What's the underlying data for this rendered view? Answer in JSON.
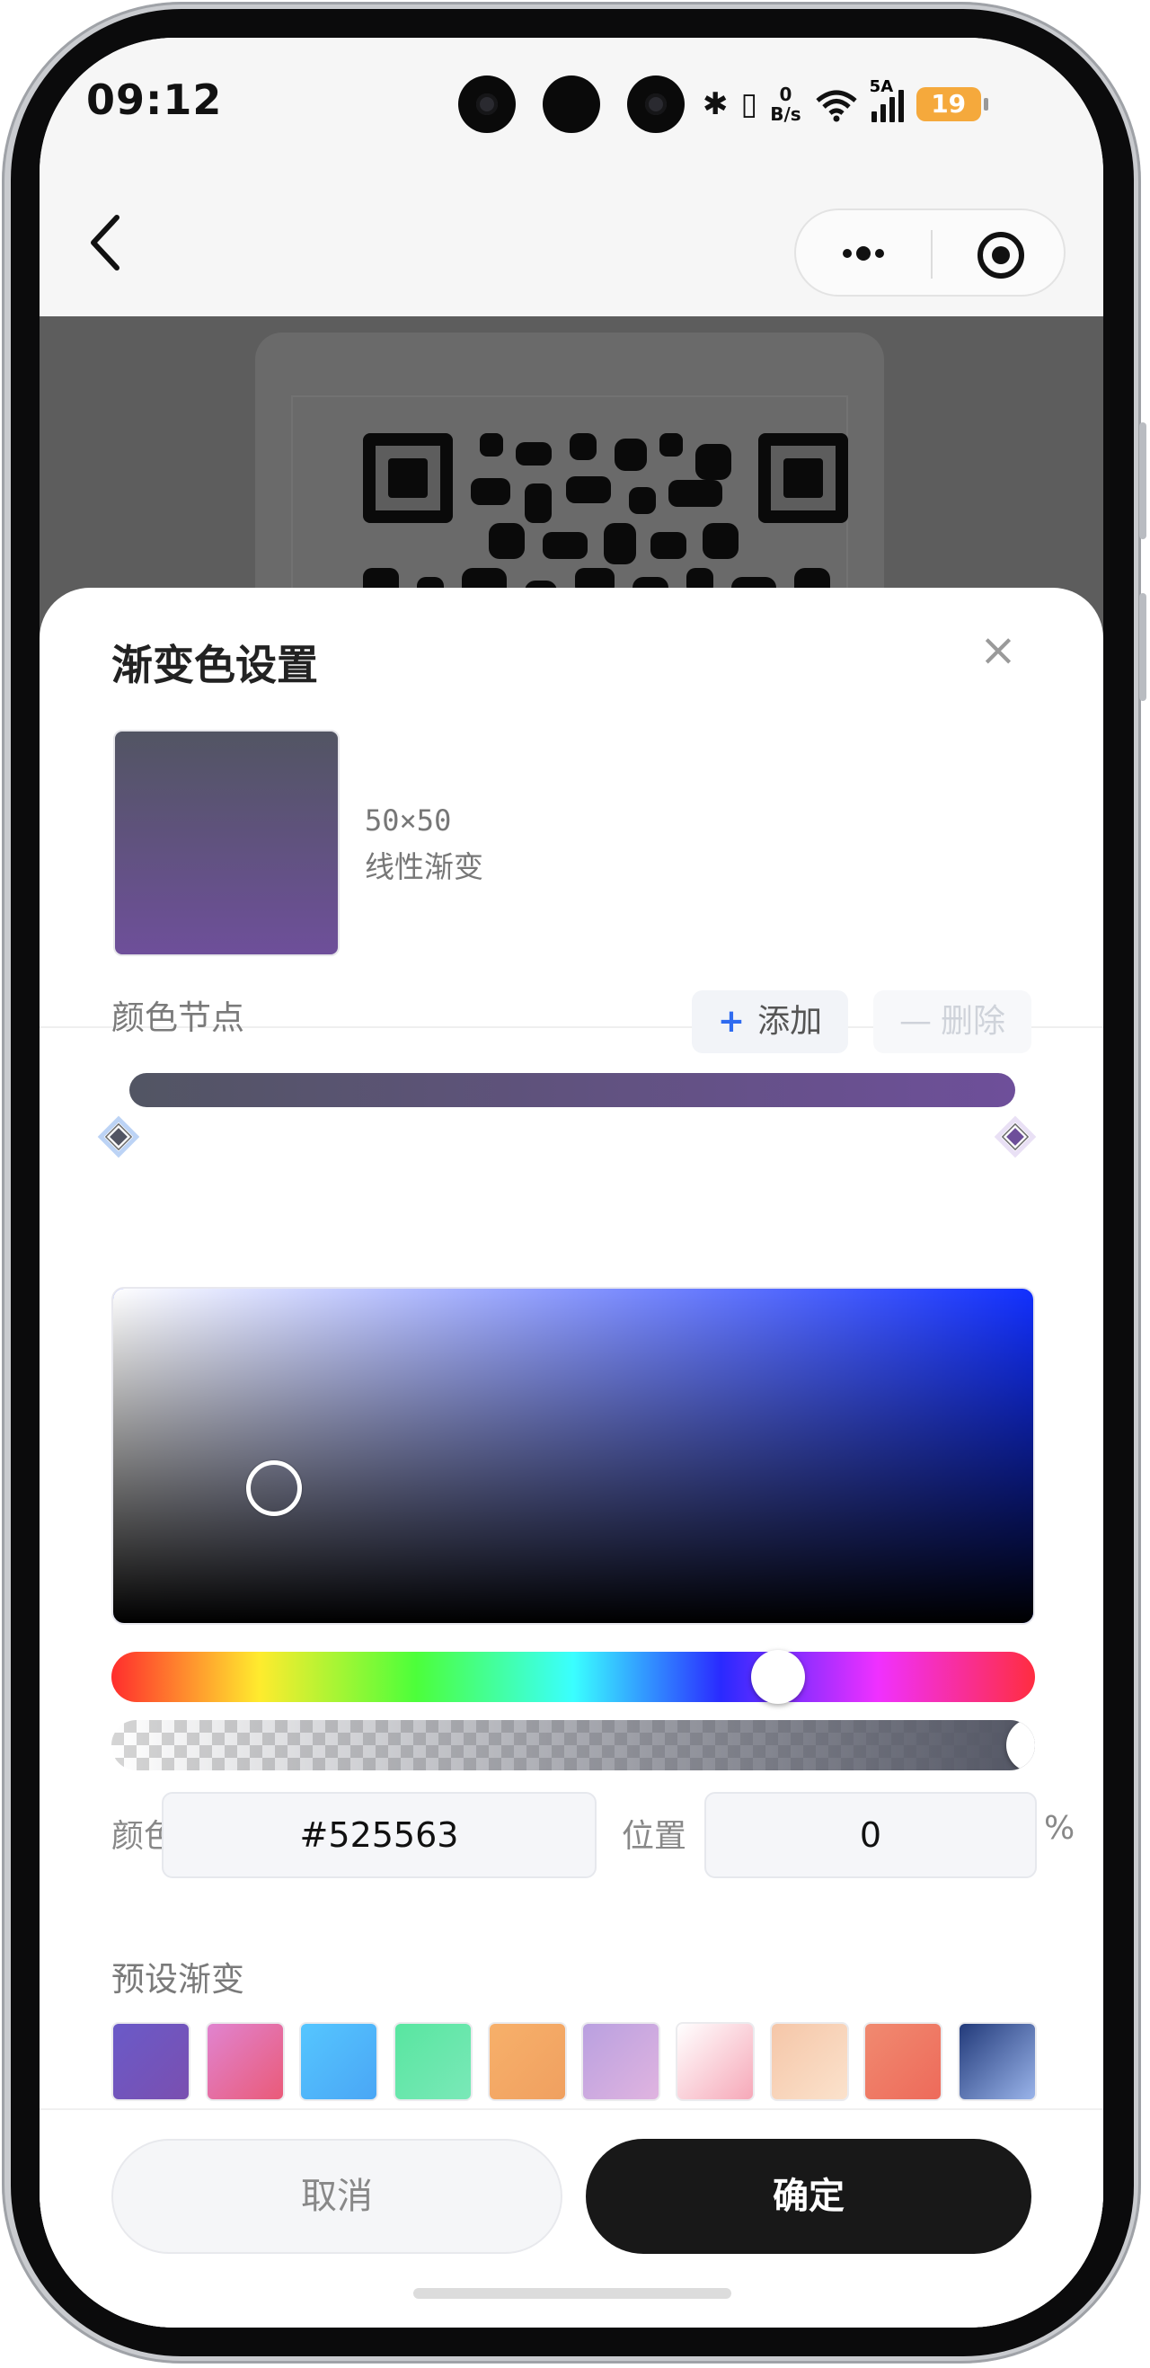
{
  "status_bar": {
    "time": "09:12",
    "speed_value": "0",
    "speed_unit": "B/s",
    "network": "5A",
    "battery": "19"
  },
  "nav": {
    "back_icon": "chevron-left-icon",
    "more_icon": "more-dots-icon",
    "target_icon": "target-icon"
  },
  "sheet": {
    "title": "渐变色设置",
    "close_glyph": "×",
    "preview": {
      "size": "50×50",
      "type": "线性渐变"
    },
    "stops_section": {
      "label": "颜色节点",
      "add_label": "添加",
      "add_glyph": "+",
      "delete_label": "删除",
      "delete_glyph": "—",
      "stops": [
        {
          "color": "#525563",
          "position": 0,
          "selected": true
        },
        {
          "color": "#6e4f9a",
          "position": 100,
          "selected": false
        }
      ]
    },
    "picker": {
      "hue_color": "#1230ff",
      "color_label": "颜色",
      "color_value": "#525563",
      "position_label": "位置",
      "position_value": "0",
      "position_unit": "%"
    },
    "presets": {
      "label": "预设渐变",
      "items": [
        {
          "from": "#6a5ac8",
          "to": "#7a4fb0"
        },
        {
          "from": "#e084d0",
          "to": "#ea5a78"
        },
        {
          "from": "#55c6ff",
          "to": "#4aa6f5"
        },
        {
          "from": "#58e6a0",
          "to": "#7ae8b8"
        },
        {
          "from": "#f7b06a",
          "to": "#f0a060"
        },
        {
          "from": "#b9a0e0",
          "to": "#e0b4e0"
        },
        {
          "from": "#ffffff",
          "to": "#f6a8b8"
        },
        {
          "from": "#f5c6a8",
          "to": "#fbe2cc"
        },
        {
          "from": "#f08a70",
          "to": "#ee6a5a"
        },
        {
          "from": "#223a7a",
          "to": "#9ab4ea"
        }
      ]
    },
    "footer": {
      "cancel_label": "取消",
      "confirm_label": "确定"
    }
  }
}
